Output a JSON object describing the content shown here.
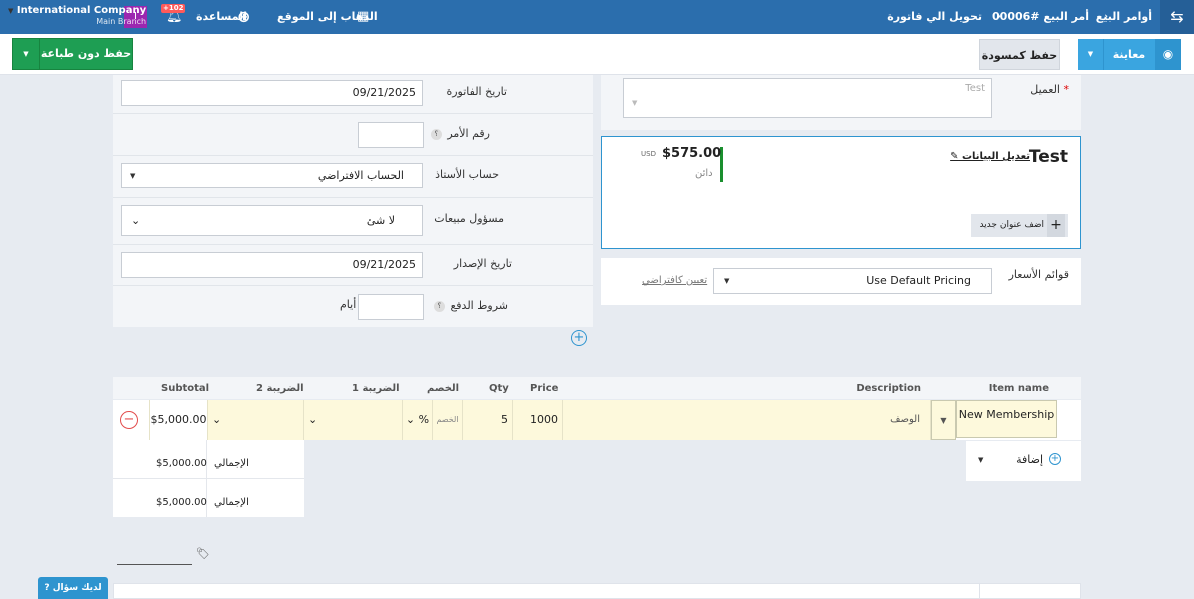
{
  "topbar": {
    "breadcrumb_1": "أوامر البيع",
    "breadcrumb_2": "أمر البيع #00006",
    "breadcrumb_3": "تحويل الي فاتورة",
    "visit_site": "الذهاب إلى الموقع",
    "help": "المساعدة",
    "notif_count": "+102",
    "user_initial": "I",
    "company_name": "International Company",
    "branch": "Main Branch"
  },
  "toolbar": {
    "save_no_print": "حفظ دون طباعة",
    "save_draft": "حفظ كمسودة",
    "preview": "معاينة"
  },
  "client": {
    "label": "العميل",
    "required_mark": "*",
    "placeholder": "Test",
    "card_name": "Test",
    "edit_link": "تعديل البيانات",
    "amount": "$575.00",
    "currency": "USD",
    "status": "دائن",
    "add_address": "اضف عنوان جديد"
  },
  "pricing": {
    "label": "قوائم الأسعار",
    "value": "Use Default Pricing",
    "set_default": "تعيين كافتراضي"
  },
  "invoice": {
    "date_label": "تاريخ الفاتورة",
    "date_value": "09/21/2025",
    "order_no_label": "رقم الأمر",
    "account_label": "حساب الأستاذ",
    "account_value": "الحساب الافتراضي",
    "sales_rep_label": "مسؤول مبيعات",
    "sales_rep_value": "لا شئ",
    "issue_date_label": "تاريخ الإصدار",
    "issue_date_value": "09/21/2025",
    "payment_terms_label": "شروط الدفع",
    "days": "أيام",
    "help_glyph": "؟"
  },
  "items": {
    "headers": {
      "item_name": "Item name",
      "description": "Description",
      "price": "Price",
      "qty": "Qty",
      "discount": "الخصم",
      "tax1": "الضريبة 1",
      "tax2": "الضريبة 2",
      "subtotal": "Subtotal"
    },
    "row": {
      "item_name": "New Membership",
      "description": "الوصف",
      "price": "1000",
      "qty": "5",
      "discount_ph": "الخصم",
      "discount_type": "%",
      "subtotal": "$5,000.00"
    },
    "add_label": "إضافة",
    "totals": [
      {
        "label": "الإجمالي",
        "value": "$5,000.00"
      },
      {
        "label": "الإجمالي",
        "value": "$5,000.00"
      }
    ]
  },
  "help_button": "لديك سؤال"
}
